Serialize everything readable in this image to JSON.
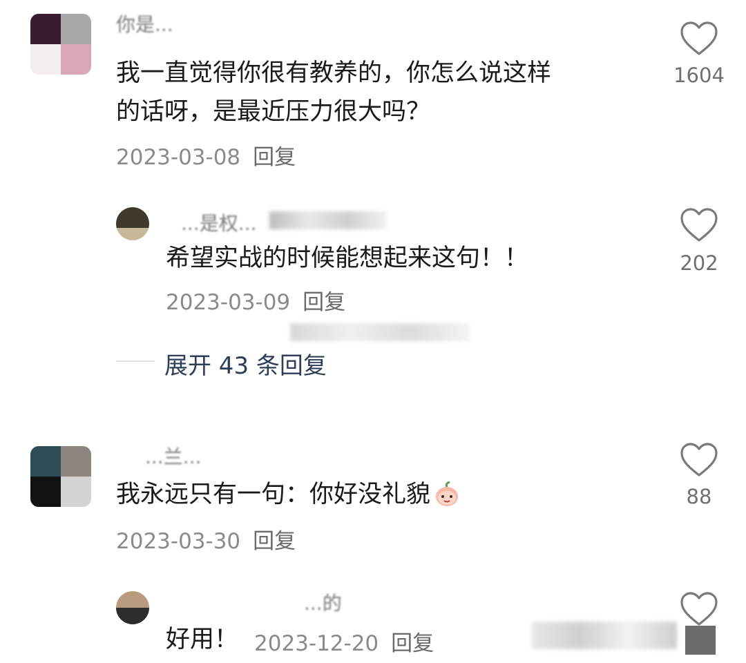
{
  "comments": [
    {
      "username": "你是...",
      "text_line1": "我一直觉得你很有教养的，你怎么说这样",
      "text_line2": "的话呀，是最近压力很大吗？",
      "date": "2023-03-08",
      "reply_label": "回复",
      "likes": "1604",
      "reply": {
        "username": "...是权...",
        "text": "希望实战的时候能想起来这句！！",
        "date": "2023-03-09",
        "reply_label": "回复",
        "likes": "202"
      },
      "expand_label": "展开 43 条回复"
    },
    {
      "username": "...兰...",
      "text": "我永远只有一句：你好没礼貌",
      "emoji": "peach-face-emoji",
      "date": "2023-03-30",
      "reply_label": "回复",
      "likes": "88",
      "reply": {
        "username": "...的",
        "text": "好用！",
        "date": "2023-12-20",
        "reply_label": "回复"
      }
    }
  ],
  "colors": {
    "text": "#1a1a1a",
    "meta": "#8a8a8a",
    "expand": "#2c3e5a",
    "heart": "#7a7a7a"
  }
}
